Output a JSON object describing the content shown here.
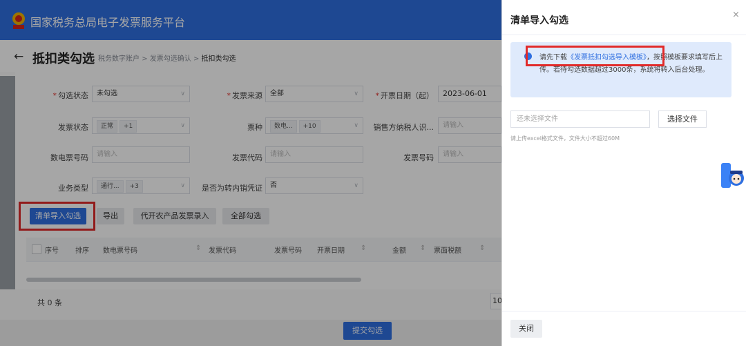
{
  "header": {
    "brand": "国家税务总局电子发票服务平台"
  },
  "page": {
    "back_icon": "arrow-left-icon",
    "title": "抵扣类勾选",
    "breadcrumb": {
      "a": "税务数字账户",
      "sep": ">",
      "b": "发票勾选确认",
      "c": "抵扣类勾选"
    }
  },
  "filters": {
    "check_status": {
      "label": "勾选状态",
      "value": "未勾选"
    },
    "invoice_source": {
      "label": "发票来源",
      "value": "全部"
    },
    "issue_date": {
      "label": "开票日期（起）",
      "value": "2023-06-01"
    },
    "invoice_status": {
      "label": "发票状态",
      "tag": "正常",
      "more": "+1"
    },
    "invoice_type": {
      "label": "票种",
      "tag": "数电...",
      "more": "+10"
    },
    "seller_tax_id": {
      "label": "销售方纳税人识...",
      "placeholder": "请输入"
    },
    "digital_no": {
      "label": "数电票号码",
      "placeholder": "请输入"
    },
    "invoice_code": {
      "label": "发票代码",
      "placeholder": "请输入"
    },
    "invoice_no": {
      "label": "发票号码",
      "placeholder": "请输入"
    },
    "biz_type": {
      "label": "业务类型",
      "tag": "通行...",
      "more": "+3"
    },
    "transfer": {
      "label": "是否为转内销凭证",
      "value": "否"
    }
  },
  "actions": {
    "import_check": "清单导入勾选",
    "export": "导出",
    "agri_entry": "代开农产品发票录入",
    "check_all": "全部勾选"
  },
  "table": {
    "headers": {
      "seq": "序号",
      "sort": "排序",
      "digital_no": "数电票号码",
      "invoice_code": "发票代码",
      "invoice_no": "发票号码",
      "issue_date": "开票日期",
      "amount": "金额",
      "tax": "票面税额"
    }
  },
  "pagination": {
    "total": "共 0 条",
    "page": "10"
  },
  "footer": {
    "submit": "提交勾选"
  },
  "drawer": {
    "title": "清单导入勾选",
    "close_icon": "×",
    "alert": {
      "prefix": "请先下载",
      "link": "《发票抵扣勾选导入模板》",
      "suffix": "，按照模板要求填写后上传。若待勾选数据超过3000条，系统将转入后台处理。"
    },
    "file": {
      "placeholder": "还未选择文件",
      "button": "选择文件",
      "hint": "请上传excel格式文件，文件大小不超过60M"
    },
    "close_button": "关闭"
  },
  "colors": {
    "primary": "#2f6fe0",
    "highlight": "#e12a2a",
    "alert_bg": "#dfeafc"
  }
}
